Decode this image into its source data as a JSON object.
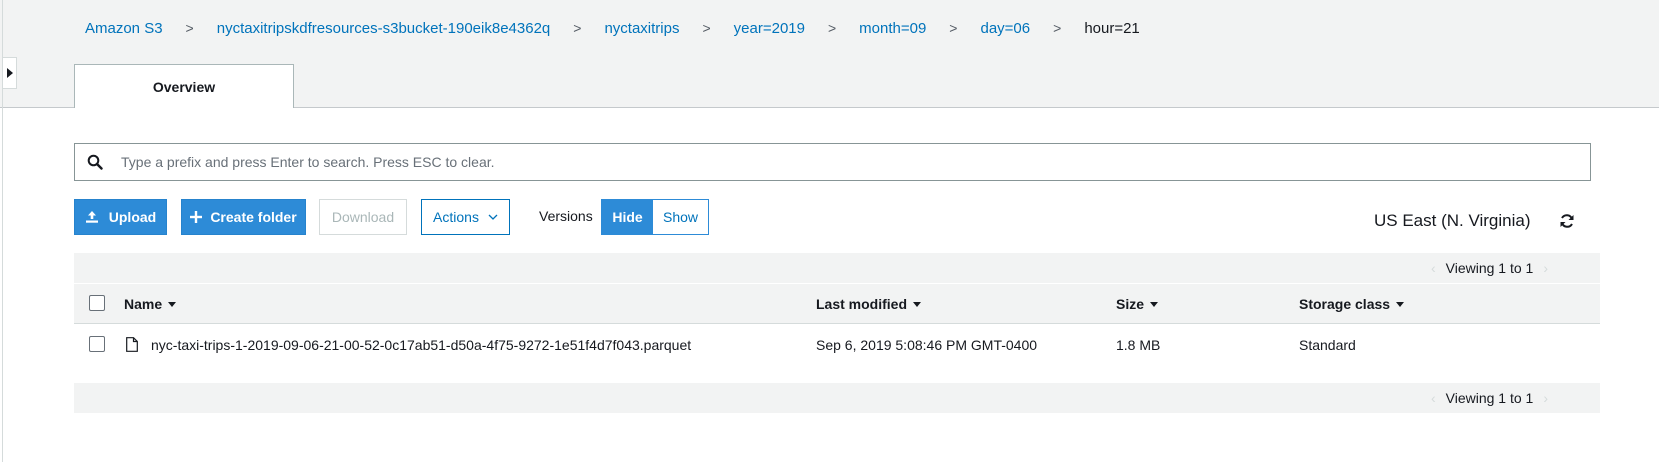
{
  "breadcrumb": [
    {
      "label": "Amazon S3",
      "link": true
    },
    {
      "label": "nyctaxitripskdfresources-s3bucket-190eik8e4362q",
      "link": true
    },
    {
      "label": "nyctaxitrips",
      "link": true
    },
    {
      "label": "year=2019",
      "link": true
    },
    {
      "label": "month=09",
      "link": true
    },
    {
      "label": "day=06",
      "link": true
    },
    {
      "label": "hour=21",
      "link": false
    }
  ],
  "breadcrumb_separator": ">",
  "tabs": {
    "overview": "Overview"
  },
  "search": {
    "placeholder": "Type a prefix and press Enter to search. Press ESC to clear."
  },
  "toolbar": {
    "upload": "Upload",
    "create_folder": "Create folder",
    "download": "Download",
    "actions": "Actions",
    "versions_label": "Versions",
    "hide": "Hide",
    "show": "Show"
  },
  "region": "US East (N. Virginia)",
  "pager": {
    "top": "Viewing 1 to 1",
    "bottom": "Viewing 1 to 1"
  },
  "table": {
    "columns": [
      "Name",
      "Last modified",
      "Size",
      "Storage class"
    ],
    "rows": [
      {
        "name": "nyc-taxi-trips-1-2019-09-06-21-00-52-0c17ab51-d50a-4f75-9272-1e51f4d7f043.parquet",
        "last_modified": "Sep 6, 2019 5:08:46 PM GMT-0400",
        "size": "1.8 MB",
        "storage_class": "Standard"
      }
    ]
  },
  "colors": {
    "accent": "#2d8bd7",
    "link": "#0073bb",
    "header_bg": "#f2f3f3"
  }
}
